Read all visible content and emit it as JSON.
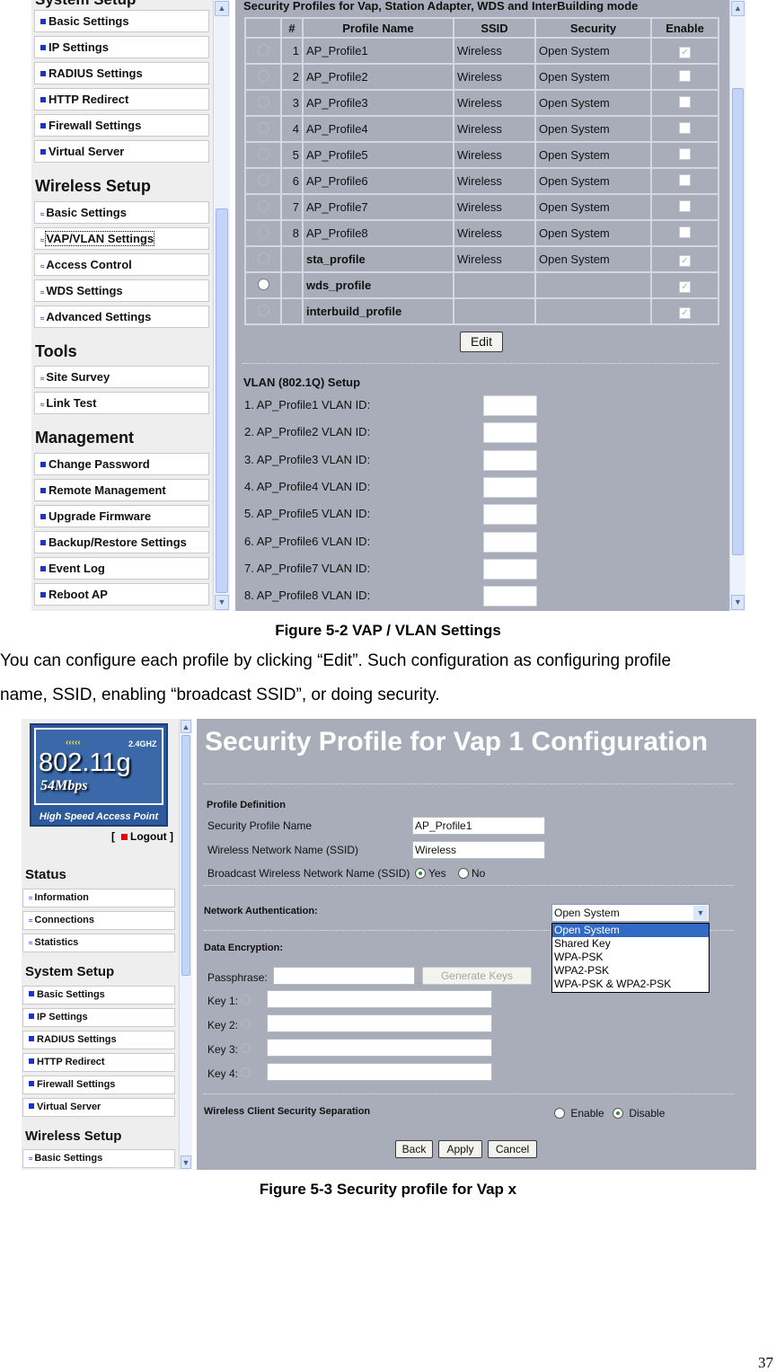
{
  "fig1": {
    "sidebar": {
      "top_heading": "System Setup",
      "system_items": [
        "Basic Settings",
        "IP Settings",
        "RADIUS Settings",
        "HTTP Redirect",
        "Firewall Settings",
        "Virtual Server"
      ],
      "wireless_heading": "Wireless Setup",
      "wireless_items": [
        "Basic Settings",
        "VAP/VLAN Settings",
        "Access Control",
        "WDS Settings",
        "Advanced Settings"
      ],
      "tools_heading": "Tools",
      "tools_items": [
        "Site Survey",
        "Link Test"
      ],
      "management_heading": "Management",
      "management_items": [
        "Change Password",
        "Remote Management",
        "Upgrade Firmware",
        "Backup/Restore Settings",
        "Event Log",
        "Reboot AP"
      ]
    },
    "table_title": "Security Profiles for Vap, Station Adapter, WDS and InterBuilding mode",
    "columns": [
      "#",
      "Profile Name",
      "SSID",
      "Security",
      "Enable"
    ],
    "rows": [
      {
        "num": "1",
        "name": "AP_Profile1",
        "ssid": "Wireless",
        "security": "Open System",
        "enabled": true,
        "selected": false
      },
      {
        "num": "2",
        "name": "AP_Profile2",
        "ssid": "Wireless",
        "security": "Open System",
        "enabled": false,
        "selected": false
      },
      {
        "num": "3",
        "name": "AP_Profile3",
        "ssid": "Wireless",
        "security": "Open System",
        "enabled": false,
        "selected": false
      },
      {
        "num": "4",
        "name": "AP_Profile4",
        "ssid": "Wireless",
        "security": "Open System",
        "enabled": false,
        "selected": false
      },
      {
        "num": "5",
        "name": "AP_Profile5",
        "ssid": "Wireless",
        "security": "Open System",
        "enabled": false,
        "selected": false
      },
      {
        "num": "6",
        "name": "AP_Profile6",
        "ssid": "Wireless",
        "security": "Open System",
        "enabled": false,
        "selected": false
      },
      {
        "num": "7",
        "name": "AP_Profile7",
        "ssid": "Wireless",
        "security": "Open System",
        "enabled": false,
        "selected": false
      },
      {
        "num": "8",
        "name": "AP_Profile8",
        "ssid": "Wireless",
        "security": "Open System",
        "enabled": false,
        "selected": false
      },
      {
        "num": "",
        "name": "sta_profile",
        "ssid": "Wireless",
        "security": "Open System",
        "enabled": true,
        "selected": false,
        "bold": true
      },
      {
        "num": "",
        "name": "wds_profile",
        "ssid": "",
        "security": "",
        "enabled": true,
        "selected": true,
        "bold": true
      },
      {
        "num": "",
        "name": "interbuild_profile",
        "ssid": "",
        "security": "",
        "enabled": true,
        "selected": false,
        "bold": true
      }
    ],
    "edit_label": "Edit",
    "vlan_heading": "VLAN (802.1Q) Setup",
    "vlan_labels": [
      "1. AP_Profile1 VLAN ID:",
      "2. AP_Profile2 VLAN ID:",
      "3. AP_Profile3 VLAN ID:",
      "4. AP_Profile4 VLAN ID:",
      "5. AP_Profile5 VLAN ID:",
      "6. AP_Profile6 VLAN ID:",
      "7. AP_Profile7 VLAN ID:",
      "8. AP_Profile8 VLAN ID:"
    ]
  },
  "caption1": "Figure 5-2 VAP / VLAN Settings",
  "paragraph": [
    "You can configure each profile by clicking “Edit”. Such configuration as configuring profile",
    "name, SSID, enabling “broadcast SSID”, or doing security."
  ],
  "fig2": {
    "logo": {
      "band": "2.4GHZ",
      "standard": "802.11g",
      "speed": "54Mbps",
      "tagline": "High Speed Access Point"
    },
    "logout": "Logout",
    "status_heading": "Status",
    "status_items": [
      "Information",
      "Connections",
      "Statistics"
    ],
    "system_heading": "System Setup",
    "system_items": [
      "Basic Settings",
      "IP Settings",
      "RADIUS Settings",
      "HTTP Redirect",
      "Firewall Settings",
      "Virtual Server"
    ],
    "wireless_heading": "Wireless Setup",
    "wireless_items": [
      "Basic Settings"
    ],
    "title": "Security Profile for Vap 1 Configuration",
    "profile_definition": "Profile Definition",
    "profile_name_label": "Security Profile Name",
    "profile_name_value": "AP_Profile1",
    "ssid_label": "Wireless Network Name (SSID)",
    "ssid_value": "Wireless",
    "broadcast_label": "Broadcast Wireless Network Name (SSID)",
    "yes": "Yes",
    "no": "No",
    "net_auth_label": "Network Authentication:",
    "net_auth_value": "Open System",
    "net_auth_options": [
      "Open System",
      "Shared Key",
      "WPA-PSK",
      "WPA2-PSK",
      "WPA-PSK & WPA2-PSK"
    ],
    "data_enc_label": "Data Encryption:",
    "passphrase_label": "Passphrase:",
    "generate_keys": "Generate Keys",
    "key_labels": [
      "Key 1:",
      "Key 2:",
      "Key 3:",
      "Key 4:"
    ],
    "separation_label": "Wireless Client Security Separation",
    "enable": "Enable",
    "disable": "Disable",
    "back": "Back",
    "apply": "Apply",
    "cancel": "Cancel"
  },
  "caption2": "Figure 5-3 Security profile for Vap x",
  "page_number": "37"
}
